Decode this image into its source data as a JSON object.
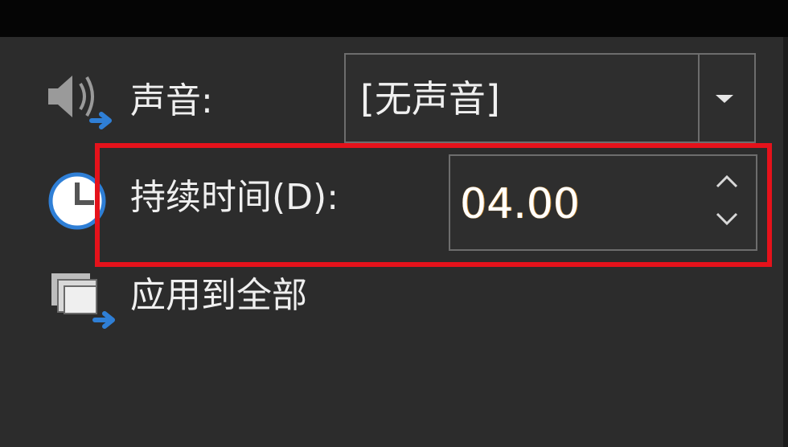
{
  "sound": {
    "label": "声音:",
    "value": "[无声音]",
    "icon": "speaker-icon"
  },
  "duration": {
    "label": "持续时间(D):",
    "value": "04.00",
    "icon": "clock-icon",
    "highlight_color": "#e5121b"
  },
  "apply_all": {
    "label": "应用到全部",
    "icon": "apply-all-icon"
  },
  "colors": {
    "background": "#2c2c2c",
    "border": "#6d6d6d",
    "accent_blue": "#2f7fd6"
  }
}
